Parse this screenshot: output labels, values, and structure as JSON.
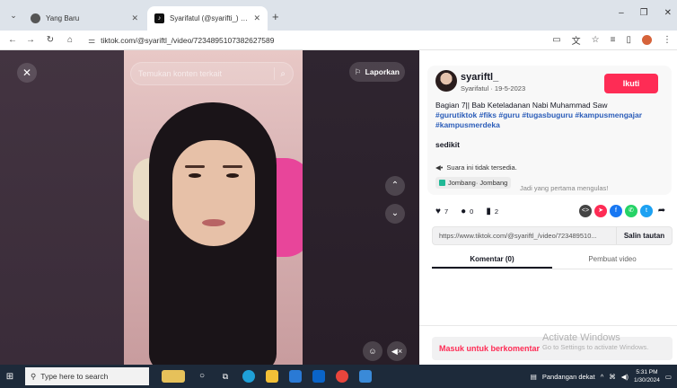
{
  "browser": {
    "tabs": [
      {
        "title": "Yang Baru",
        "active": false
      },
      {
        "title": "Syarifatul (@syarifti_) | TikTok",
        "active": true
      }
    ],
    "url": "tiktok.com/@syariftl_/video/7234895107382627589"
  },
  "video": {
    "search_placeholder": "Temukan konten terkait",
    "report_label": "Laporkan"
  },
  "author": {
    "name": "syariftl_",
    "sub": "Syarifatul · 19-5-2023",
    "follow_label": "Ikuti"
  },
  "caption": {
    "text": "Bagian 7|| Bab Keteladanan Nabi Muhammad Saw",
    "tags": "#gurutiktok #fiks #guru #tugasbuguru #kampusmengajar #kampusmerdeka",
    "extra": "sedikit"
  },
  "sound": {
    "label": "Suara ini tidak tersedia."
  },
  "location": {
    "label": "Jombang· Jombang"
  },
  "first_comment_prompt": "Jadi yang pertama mengulas!",
  "stats": {
    "likes": "7",
    "comments": "0",
    "saves": "2"
  },
  "share_link": {
    "url": "https://www.tiktok.com/@syariftl_/video/723489510...",
    "copy_label": "Salin tautan"
  },
  "tabs": [
    {
      "label": "Komentar (0)",
      "selected": true
    },
    {
      "label": "Pembuat video",
      "selected": false
    }
  ],
  "comment_bar": {
    "login_label": "Masuk untuk berkomentar"
  },
  "watermark": {
    "line1": "Activate Windows",
    "line2": "Go to Settings to activate Windows."
  },
  "taskbar": {
    "search_placeholder": "Type here to search",
    "news": "Pandangan dekat",
    "time": "5:31 PM",
    "date": "1/30/2024"
  },
  "colors": {
    "accent": "#fe2c55",
    "hashtag": "#2b5db9"
  }
}
